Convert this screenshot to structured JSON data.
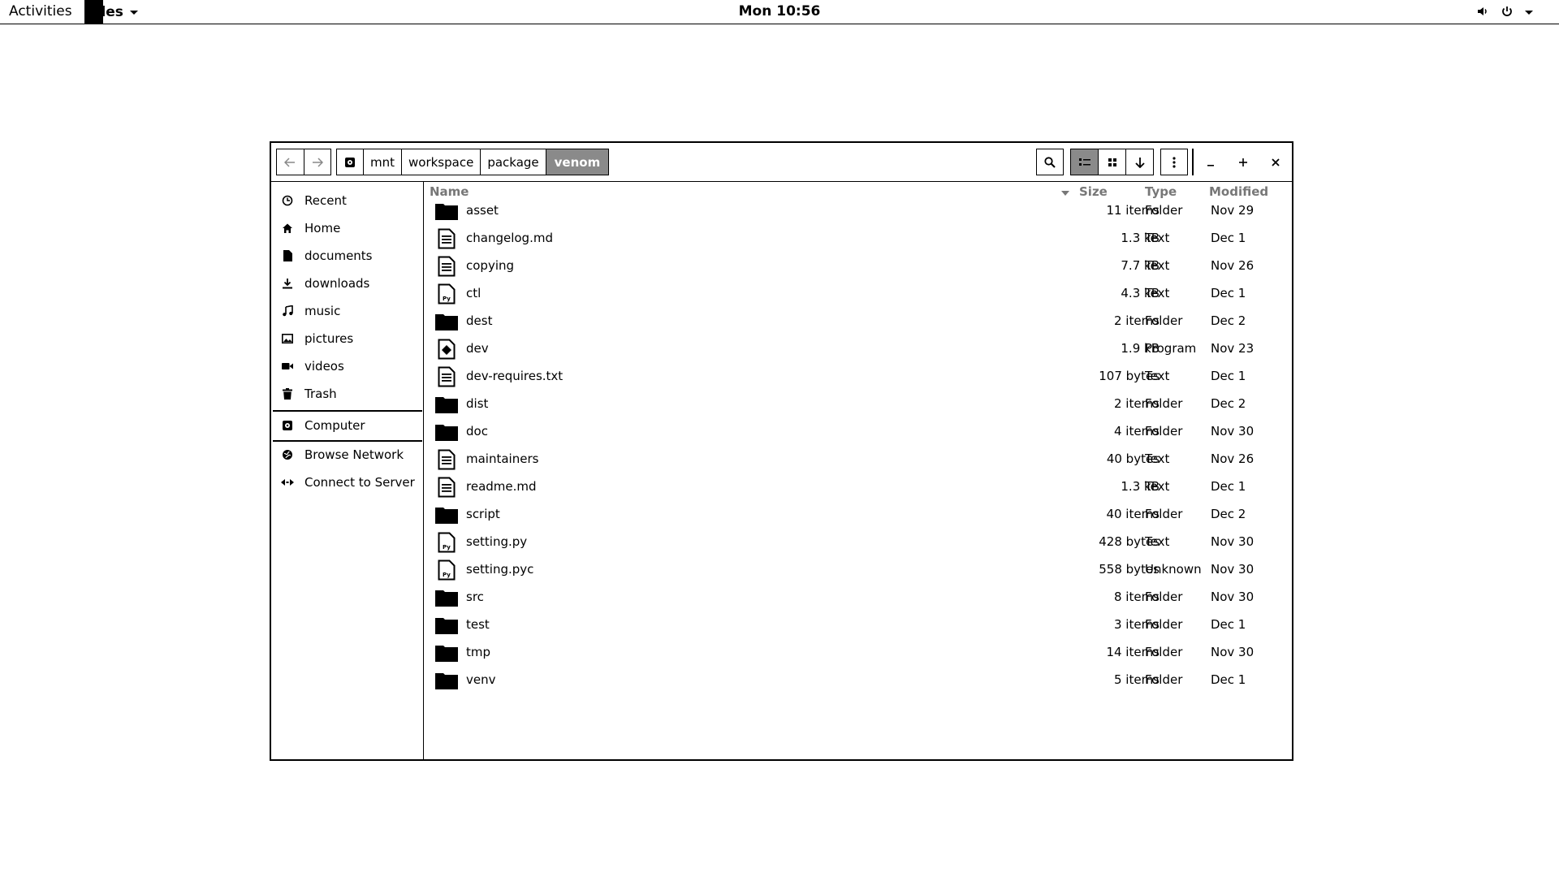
{
  "topbar": {
    "activities": "Activities",
    "app_name": "Files",
    "clock": "Mon 10:56"
  },
  "path": [
    "mnt",
    "workspace",
    "package",
    "venom"
  ],
  "sidebar": {
    "places": [
      {
        "label": "Recent",
        "icon": "clock-icon"
      },
      {
        "label": "Home",
        "icon": "home-icon"
      },
      {
        "label": "documents",
        "icon": "document-icon"
      },
      {
        "label": "downloads",
        "icon": "download-icon"
      },
      {
        "label": "music",
        "icon": "music-icon"
      },
      {
        "label": "pictures",
        "icon": "picture-icon"
      },
      {
        "label": "videos",
        "icon": "video-icon"
      },
      {
        "label": "Trash",
        "icon": "trash-icon"
      }
    ],
    "computer": "Computer",
    "network": [
      {
        "label": "Browse Network",
        "icon": "network-icon"
      },
      {
        "label": "Connect to Server",
        "icon": "server-icon"
      }
    ]
  },
  "columns": {
    "name": "Name",
    "size": "Size",
    "type": "Type",
    "modified": "Modified"
  },
  "files": [
    {
      "name": "asset",
      "size": "11 items",
      "type": "Folder",
      "modified": "Nov 29",
      "kind": "folder"
    },
    {
      "name": "changelog.md",
      "size": "1.3 kB",
      "type": "Text",
      "modified": "Dec 1",
      "kind": "text"
    },
    {
      "name": "copying",
      "size": "7.7 kB",
      "type": "Text",
      "modified": "Nov 26",
      "kind": "text"
    },
    {
      "name": "ctl",
      "size": "4.3 kB",
      "type": "Text",
      "modified": "Dec 1",
      "kind": "python"
    },
    {
      "name": "dest",
      "size": "2 items",
      "type": "Folder",
      "modified": "Dec 2",
      "kind": "folder"
    },
    {
      "name": "dev",
      "size": "1.9 kB",
      "type": "Program",
      "modified": "Nov 23",
      "kind": "program"
    },
    {
      "name": "dev-requires.txt",
      "size": "107 bytes",
      "type": "Text",
      "modified": "Dec 1",
      "kind": "text"
    },
    {
      "name": "dist",
      "size": "2 items",
      "type": "Folder",
      "modified": "Dec 2",
      "kind": "folder"
    },
    {
      "name": "doc",
      "size": "4 items",
      "type": "Folder",
      "modified": "Nov 30",
      "kind": "folder"
    },
    {
      "name": "maintainers",
      "size": "40 bytes",
      "type": "Text",
      "modified": "Nov 26",
      "kind": "text"
    },
    {
      "name": "readme.md",
      "size": "1.3 kB",
      "type": "Text",
      "modified": "Dec 1",
      "kind": "text"
    },
    {
      "name": "script",
      "size": "40 items",
      "type": "Folder",
      "modified": "Dec 2",
      "kind": "folder"
    },
    {
      "name": "setting.py",
      "size": "428 bytes",
      "type": "Text",
      "modified": "Nov 30",
      "kind": "python"
    },
    {
      "name": "setting.pyc",
      "size": "558 bytes",
      "type": "Unknown",
      "modified": "Nov 30",
      "kind": "python"
    },
    {
      "name": "src",
      "size": "8 items",
      "type": "Folder",
      "modified": "Nov 30",
      "kind": "folder"
    },
    {
      "name": "test",
      "size": "3 items",
      "type": "Folder",
      "modified": "Dec 1",
      "kind": "folder"
    },
    {
      "name": "tmp",
      "size": "14 items",
      "type": "Folder",
      "modified": "Nov 30",
      "kind": "folder"
    },
    {
      "name": "venv",
      "size": "5 items",
      "type": "Folder",
      "modified": "Dec 1",
      "kind": "folder"
    }
  ]
}
